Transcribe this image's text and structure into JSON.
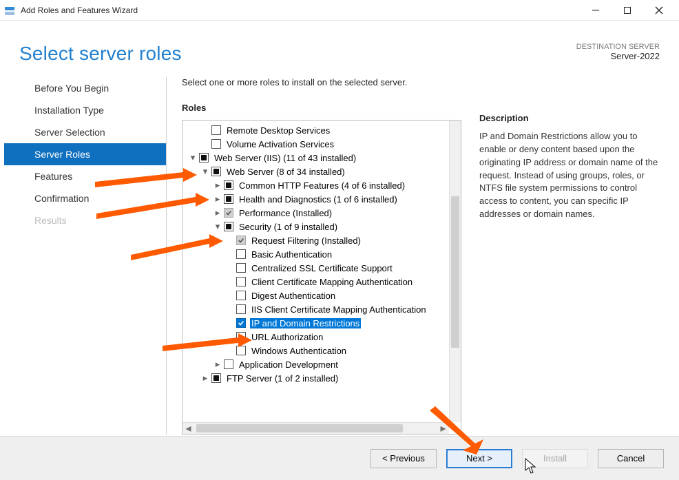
{
  "titlebar": {
    "title": "Add Roles and Features Wizard"
  },
  "header": {
    "title": "Select server roles",
    "dest_label": "DESTINATION SERVER",
    "dest_name": "Server-2022"
  },
  "sidebar": {
    "items": [
      {
        "label": "Before You Begin",
        "state": ""
      },
      {
        "label": "Installation Type",
        "state": ""
      },
      {
        "label": "Server Selection",
        "state": ""
      },
      {
        "label": "Server Roles",
        "state": "active"
      },
      {
        "label": "Features",
        "state": ""
      },
      {
        "label": "Confirmation",
        "state": ""
      },
      {
        "label": "Results",
        "state": "disabled"
      }
    ]
  },
  "main": {
    "instruction": "Select one or more roles to install on the selected server.",
    "roles_title": "Roles",
    "desc_title": "Description",
    "desc_text": "IP and Domain Restrictions allow you to enable or deny content based upon the originating IP address or domain name of the request. Instead of using groups, roles, or NTFS file system permissions to control access to content, you can specific IP addresses or domain names."
  },
  "tree": [
    {
      "indent": 1,
      "expander": "",
      "check": "empty",
      "label": "Remote Desktop Services"
    },
    {
      "indent": 1,
      "expander": "",
      "check": "empty",
      "label": "Volume Activation Services"
    },
    {
      "indent": 0,
      "expander": "open",
      "check": "partial",
      "label": "Web Server (IIS) (11 of 43 installed)"
    },
    {
      "indent": 1,
      "expander": "open",
      "check": "partial",
      "label": "Web Server (8 of 34 installed)"
    },
    {
      "indent": 2,
      "expander": "closed",
      "check": "partial",
      "label": "Common HTTP Features (4 of 6 installed)"
    },
    {
      "indent": 2,
      "expander": "closed",
      "check": "partial",
      "label": "Health and Diagnostics (1 of 6 installed)"
    },
    {
      "indent": 2,
      "expander": "closed",
      "check": "checked-gray",
      "label": "Performance (Installed)"
    },
    {
      "indent": 2,
      "expander": "open",
      "check": "partial",
      "label": "Security (1 of 9 installed)"
    },
    {
      "indent": 3,
      "expander": "",
      "check": "checked-gray",
      "label": "Request Filtering (Installed)"
    },
    {
      "indent": 3,
      "expander": "",
      "check": "empty",
      "label": "Basic Authentication"
    },
    {
      "indent": 3,
      "expander": "",
      "check": "empty",
      "label": "Centralized SSL Certificate Support"
    },
    {
      "indent": 3,
      "expander": "",
      "check": "empty",
      "label": "Client Certificate Mapping Authentication"
    },
    {
      "indent": 3,
      "expander": "",
      "check": "empty",
      "label": "Digest Authentication"
    },
    {
      "indent": 3,
      "expander": "",
      "check": "empty",
      "label": "IIS Client Certificate Mapping Authentication"
    },
    {
      "indent": 3,
      "expander": "",
      "check": "checked",
      "label": "IP and Domain Restrictions",
      "selected": true
    },
    {
      "indent": 3,
      "expander": "",
      "check": "empty",
      "label": "URL Authorization"
    },
    {
      "indent": 3,
      "expander": "",
      "check": "empty",
      "label": "Windows Authentication"
    },
    {
      "indent": 2,
      "expander": "closed",
      "check": "empty",
      "label": "Application Development"
    },
    {
      "indent": 1,
      "expander": "closed",
      "check": "partial",
      "label": "FTP Server (1 of 2 installed)"
    }
  ],
  "buttons": {
    "previous": "< Previous",
    "next": "Next >",
    "install": "Install",
    "cancel": "Cancel"
  }
}
